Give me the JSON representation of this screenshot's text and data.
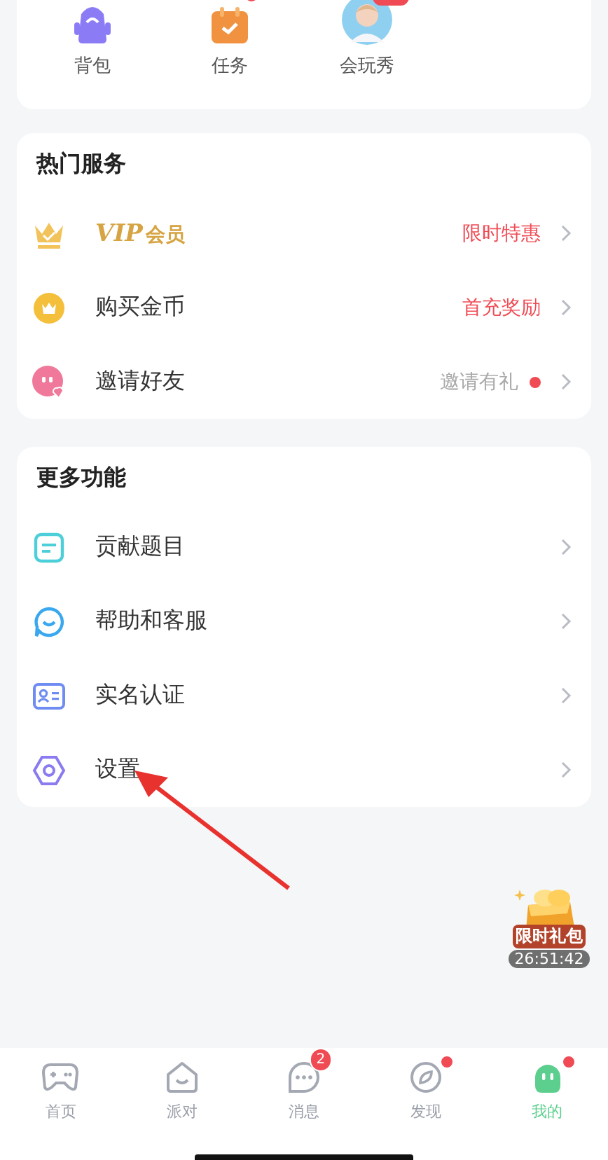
{
  "shortcuts": [
    {
      "label": "背包",
      "kind": "bag",
      "badge": false
    },
    {
      "label": "任务",
      "kind": "task",
      "badge": true
    },
    {
      "label": "会玩秀",
      "kind": "avatar",
      "badge": true
    }
  ],
  "sections": [
    {
      "title": "热门服务",
      "items": [
        {
          "label": "VIP",
          "label_suffix": "会员",
          "kind": "vip",
          "hint": "限时特惠",
          "color": "#f04b55",
          "dot": false
        },
        {
          "label": "购买金币",
          "kind": "coin",
          "hint": "首充奖励",
          "color": "#f04b55",
          "dot": false
        },
        {
          "label": "邀请好友",
          "kind": "invite",
          "hint": "邀请有礼",
          "color": "#aaaaaa",
          "dot": true
        }
      ]
    },
    {
      "title": "更多功能",
      "items": [
        {
          "label": "贡献题目",
          "kind": "doc"
        },
        {
          "label": "帮助和客服",
          "kind": "chat"
        },
        {
          "label": "实名认证",
          "kind": "id"
        },
        {
          "label": "设置",
          "kind": "settings"
        }
      ]
    }
  ],
  "gift": {
    "label": "限时礼包",
    "countdown": "26:51:42"
  },
  "tabs": [
    {
      "label": "首页",
      "kind": "game",
      "selected": false
    },
    {
      "label": "派对",
      "kind": "house",
      "selected": false
    },
    {
      "label": "消息",
      "kind": "msg",
      "selected": false,
      "badge": "2"
    },
    {
      "label": "发现",
      "kind": "compass",
      "selected": false,
      "dot": true
    },
    {
      "label": "我的",
      "kind": "me",
      "selected": true,
      "dot": true
    }
  ]
}
